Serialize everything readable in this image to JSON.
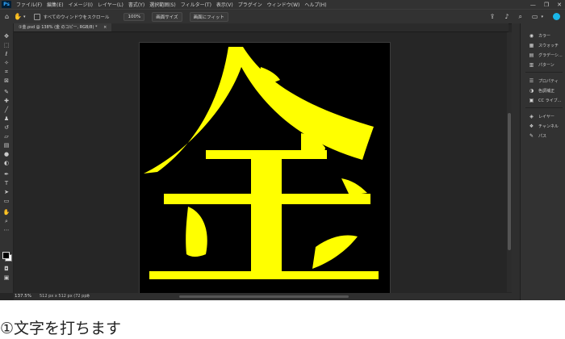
{
  "app": {
    "logo": "Ps"
  },
  "menu": [
    "ファイル(F)",
    "編集(E)",
    "イメージ(I)",
    "レイヤー(L)",
    "書式(Y)",
    "選択範囲(S)",
    "フィルター(T)",
    "表示(V)",
    "プラグイン",
    "ウィンドウ(W)",
    "ヘルプ(H)"
  ],
  "window_controls": {
    "minimize": "—",
    "restore": "❐",
    "close": "✕"
  },
  "options": {
    "checkbox_label": "すべてのウィンドウをスクロール",
    "zoom_value": "100%",
    "fit_screen_label": "画面サイズ",
    "fill_screen_label": "画面にフィット"
  },
  "document_tab": {
    "title": "①金.psd @ 138% (金 のコピー, RGB/8) *",
    "close": "×"
  },
  "canvas": {
    "glyph": "金",
    "glyph_color": "#ffff00",
    "background": "#000000"
  },
  "panels": {
    "group1": [
      "カラー",
      "スウォッチ",
      "グラデーシ...",
      "パターン"
    ],
    "group2": [
      "プロパティ",
      "色調補正",
      "CC ライブ..."
    ],
    "group3": [
      "レイヤー",
      "チャンネル",
      "パス"
    ]
  },
  "status": {
    "zoom": "137.5%",
    "doc_info": "512 px x 512 px (72 ppi)",
    "arrow": ">"
  },
  "caption": "①文字を打ちます",
  "colors": {
    "accent": "#31a8ff",
    "avatar": "#19b6e8"
  }
}
